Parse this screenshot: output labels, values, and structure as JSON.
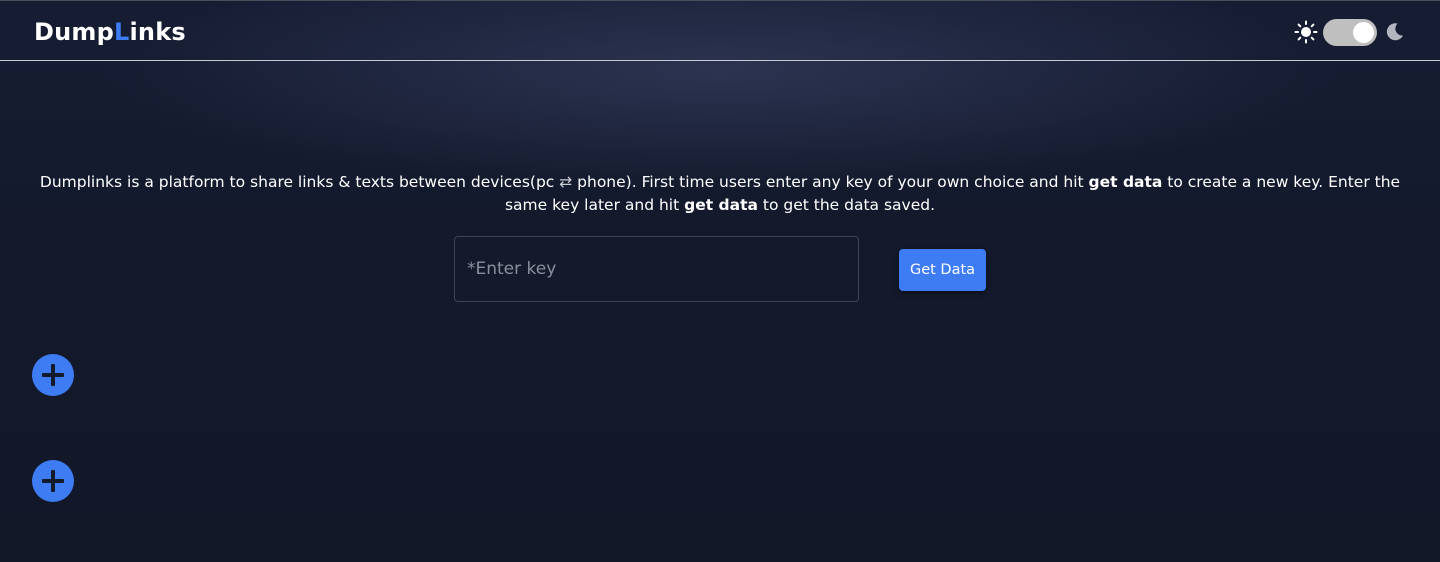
{
  "header": {
    "logo_part1": "Dump",
    "logo_accent": "L",
    "logo_part2": "inks",
    "theme_toggle": {
      "left_icon": "sun-icon",
      "right_icon": "moon-icon",
      "state": "dark"
    }
  },
  "intro": {
    "text_1": "Dumplinks is a platform to share links & texts between devices(pc ",
    "arrows": "⇄",
    "text_2": " phone). First time users enter any key of your own choice and hit ",
    "bold_1": "get data",
    "text_3": " to create a new key. Enter the same key later and hit ",
    "bold_2": "get data",
    "text_4": " to get the data saved."
  },
  "form": {
    "key_placeholder": "*Enter key",
    "key_value": "",
    "submit_label": "Get Data"
  },
  "add_buttons": [
    {
      "icon": "plus-icon"
    },
    {
      "icon": "plus-icon"
    }
  ],
  "colors": {
    "background": "#131a2c",
    "accent": "#3d7cf2",
    "toggle_track": "#bfbfbf",
    "text": "#ffffff"
  }
}
